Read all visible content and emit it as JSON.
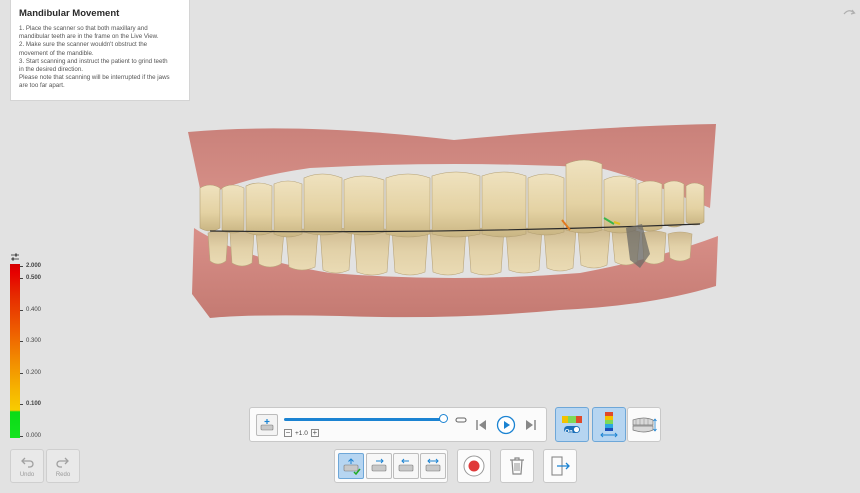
{
  "info_panel": {
    "title": "Mandibular Movement",
    "lines": [
      "1. Place the scanner so that both maxillary and",
      "mandibular teeth are in the frame on the Live View.",
      "2. Make sure the scanner wouldn't obstruct the",
      "movement of the mandible.",
      "3. Start scanning and instruct the patient to grind teeth",
      "in the desired direction.",
      "Please note that scanning will be interrupted if the jaws",
      "are too far apart."
    ]
  },
  "color_scale": {
    "ticks": [
      "2.000",
      "0.500",
      "0.400",
      "0.300",
      "0.200",
      "0.100",
      "0.000"
    ]
  },
  "playback": {
    "speed_minus": "−",
    "speed_value": "+1.0",
    "speed_plus": "+",
    "progress": 1.0
  },
  "overlay_toggle": {
    "state_label": "On"
  },
  "undo": {
    "label": "Undo"
  },
  "redo": {
    "label": "Redo"
  },
  "colors": {
    "accent": "#1b83d2",
    "active_bg": "#b6d5f1",
    "record": "#e03a3a"
  }
}
